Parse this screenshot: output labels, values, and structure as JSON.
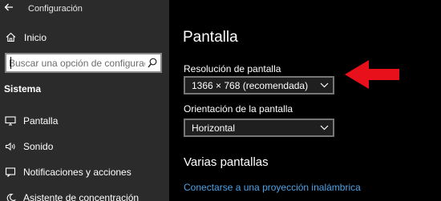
{
  "window": {
    "title": "Configuración"
  },
  "sidebar": {
    "home_label": "Inicio",
    "search": {
      "placeholder": "Buscar una opción de configuración"
    },
    "section_title": "Sistema",
    "items": [
      {
        "label": "Pantalla",
        "icon": "monitor-icon"
      },
      {
        "label": "Sonido",
        "icon": "speaker-icon"
      },
      {
        "label": "Notificaciones y acciones",
        "icon": "notification-icon"
      },
      {
        "label": "Asistente de concentración",
        "icon": "moon-icon"
      }
    ]
  },
  "main": {
    "title": "Pantalla",
    "resolution": {
      "label": "Resolución de pantalla",
      "value": "1366 × 768 (recomendada)"
    },
    "orientation": {
      "label": "Orientación de la pantalla",
      "value": "Horizontal"
    },
    "multiple_displays": {
      "title": "Varias pantallas",
      "link": "Conectarse a una proyección inalámbrica"
    }
  },
  "colors": {
    "accent_link": "#4ea3e6",
    "annotation_arrow": "#e8101a",
    "sidebar_bg": "#2b2b2b",
    "main_bg": "#000000"
  }
}
